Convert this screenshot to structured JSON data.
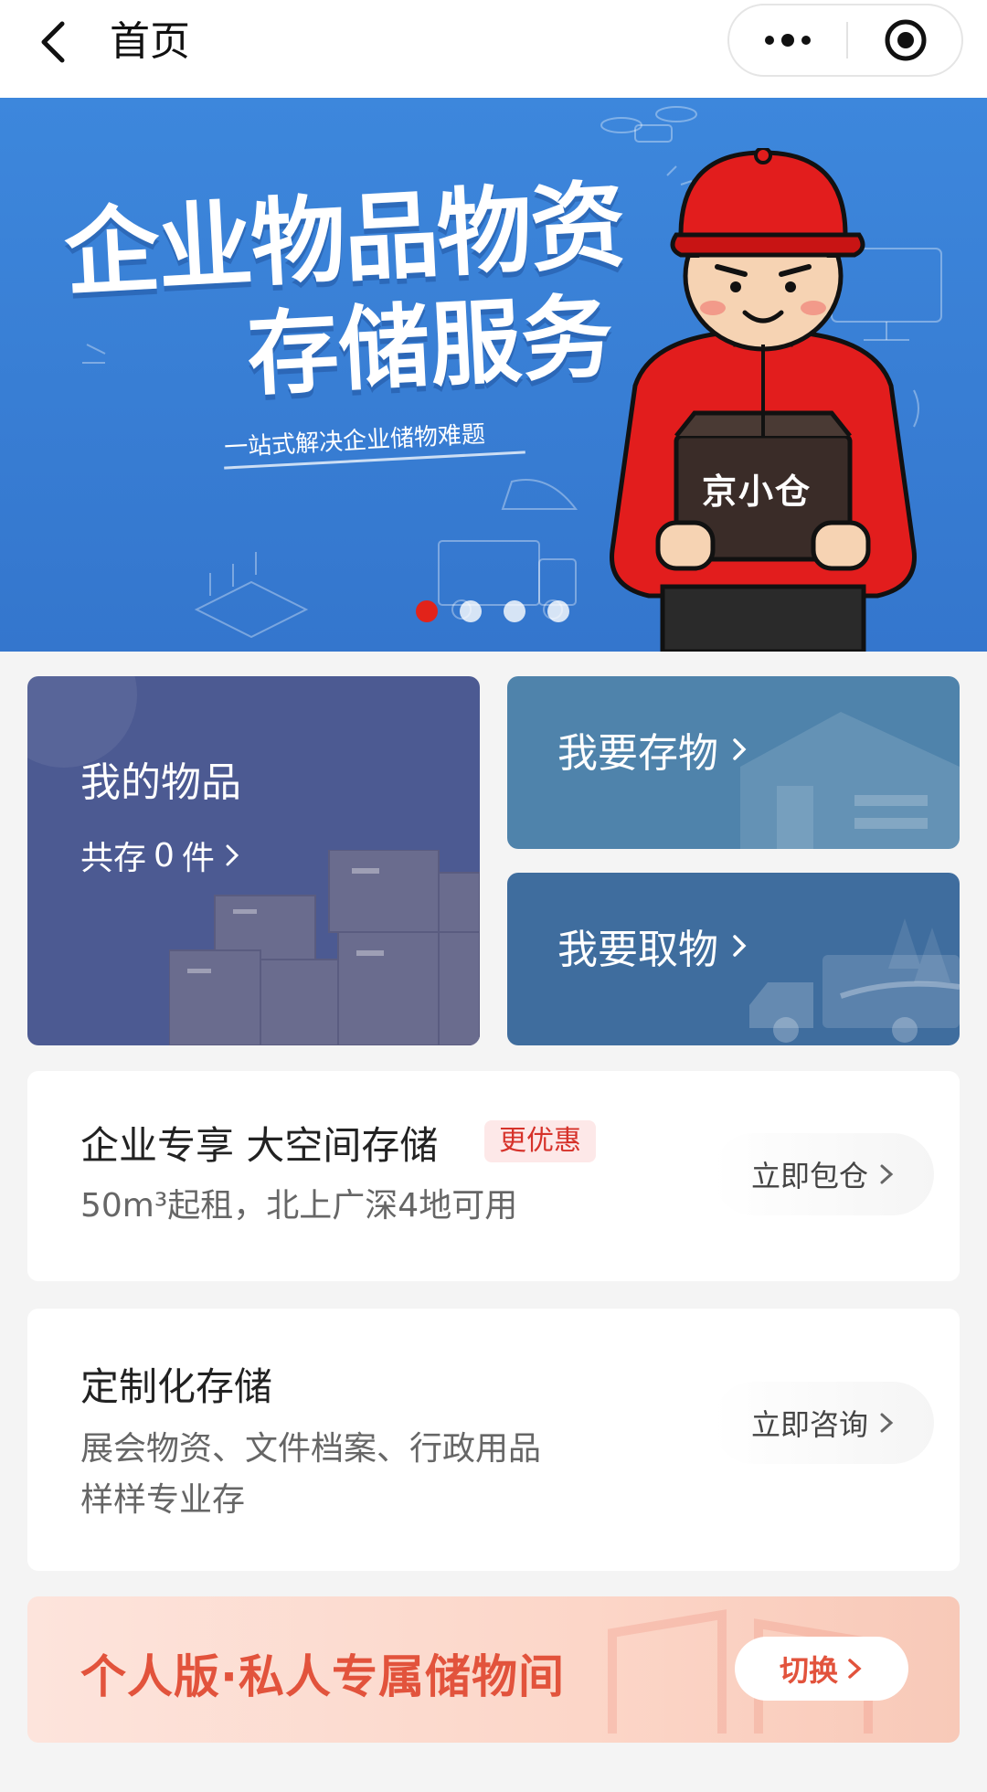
{
  "nav": {
    "title": "首页"
  },
  "banner": {
    "headline_line1": "企业物品物资",
    "headline_line2": "存储服务",
    "tagline": "一站式解决企业储物难题",
    "box_brand": "京小仓",
    "slide_count": 4,
    "active_slide": 1
  },
  "tiles": {
    "my_items": {
      "title": "我的物品",
      "count_prefix": "共存",
      "count": "0",
      "count_unit": "件"
    },
    "store": {
      "title": "我要存物"
    },
    "retrieve": {
      "title": "我要取物"
    }
  },
  "enterprise_card": {
    "heading": "企业专享 大空间存储",
    "badge": "更优惠",
    "description": "50m³起租，北上广深4地可用",
    "action": "立即包仓"
  },
  "custom_card": {
    "heading": "定制化存储",
    "description_line1": "展会物资、文件档案、行政用品",
    "description_line2": "样样专业存",
    "action": "立即咨询"
  },
  "personal_banner": {
    "title": "个人版·私人专属储物间",
    "action": "切换"
  },
  "colors": {
    "banner_blue": "#3d87dc",
    "accent_red": "#e2231a",
    "tile_items": "#4c5a92",
    "tile_store": "#4f83ab",
    "tile_retrieve": "#3f6d9e",
    "personal_text": "#e2533c"
  }
}
